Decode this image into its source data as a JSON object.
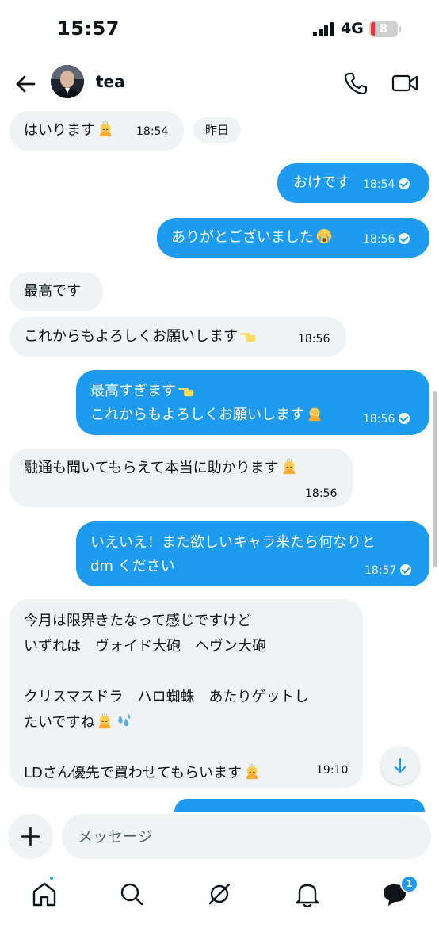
{
  "status": {
    "time": "15:57",
    "network": "4G",
    "battery": "8"
  },
  "header": {
    "name": "tea"
  },
  "date_chip": "昨日",
  "messages": [
    {
      "side": "in",
      "text": "はいります",
      "emoji": "bowing",
      "time": "18:54"
    },
    {
      "side": "out",
      "text": "おけです",
      "time": "18:54"
    },
    {
      "side": "out",
      "text": "ありがとございました",
      "emoji": "crying",
      "time": "18:56"
    },
    {
      "side": "in",
      "text": "最高です"
    },
    {
      "side": "in",
      "text": "これからもよろしくお願いします",
      "emoji": "pointing",
      "time": "18:56"
    },
    {
      "side": "out",
      "lines": [
        "最高すぎます",
        "これからもよろしくお願いします"
      ],
      "emoji": [
        "pointing",
        "bowing"
      ],
      "time": "18:56"
    },
    {
      "side": "in",
      "text": "融通も聞いてもらえて本当に助かります",
      "emoji": "bowing",
      "time": "18:56"
    },
    {
      "side": "out",
      "lines": [
        "いえいえ！また欲しいキャラ来たら何なりと",
        "dm ください"
      ],
      "time": "18:57"
    },
    {
      "side": "in",
      "lines": [
        "今月は限界きたなって感じですけど",
        "いずれは　ヴォイド大砲　ヘヴン大砲",
        "",
        "クリスマスドラ　ハロ蜘蛛　あたりゲットし",
        "たいですね",
        "",
        "LDさん優先で買わせてもらいます"
      ],
      "emoji": [
        "bowing",
        "droplets",
        "bowing"
      ],
      "time": "19:10"
    }
  ],
  "composer": {
    "placeholder": "メッセージ"
  },
  "nav": {
    "messages_badge": "1"
  },
  "colors": {
    "accent": "#1d9bf0",
    "bubble_in": "#eff3f4",
    "text": "#0f1419"
  }
}
